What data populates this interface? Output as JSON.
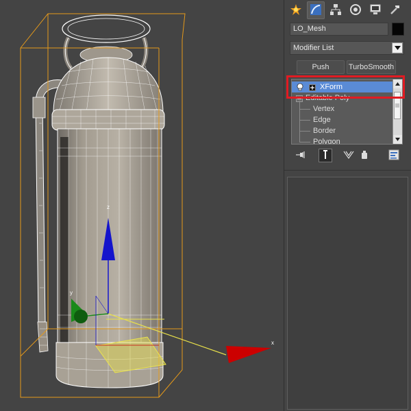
{
  "viewport": {
    "axis_labels": {
      "x": "x",
      "y": "y",
      "z": "z"
    },
    "colors": {
      "background": "#444444",
      "bbox": "#e69a1a",
      "wire": "#ffffff",
      "shading": "#a9a196",
      "x_axis": "#cc0000",
      "y_axis": "#1a8a1a",
      "z_axis": "#1414cc",
      "gizmo_plane": "#e8e04a"
    }
  },
  "command_panel": {
    "tabs": [
      {
        "icon": "create-star-icon"
      },
      {
        "icon": "modify-curve-icon"
      },
      {
        "icon": "hierarchy-icon"
      },
      {
        "icon": "motion-icon"
      },
      {
        "icon": "display-monitor-icon"
      },
      {
        "icon": "utilities-hammer-icon"
      }
    ],
    "object_name": "LO_Mesh",
    "object_color": "#050505",
    "modifier_list_label": "Modifier List",
    "modifier_sets": [
      "Push",
      "TurboSmooth"
    ],
    "stack": [
      {
        "label": "XForm",
        "selected": true
      },
      {
        "label": "Editable Poly",
        "selected": false
      },
      {
        "label": "Vertex",
        "selected": false
      },
      {
        "label": "Edge",
        "selected": false
      },
      {
        "label": "Border",
        "selected": false
      },
      {
        "label": "Polygon",
        "selected": false
      }
    ],
    "highlight_color": "#e11b22",
    "selection_color": "#5a8bd6"
  }
}
